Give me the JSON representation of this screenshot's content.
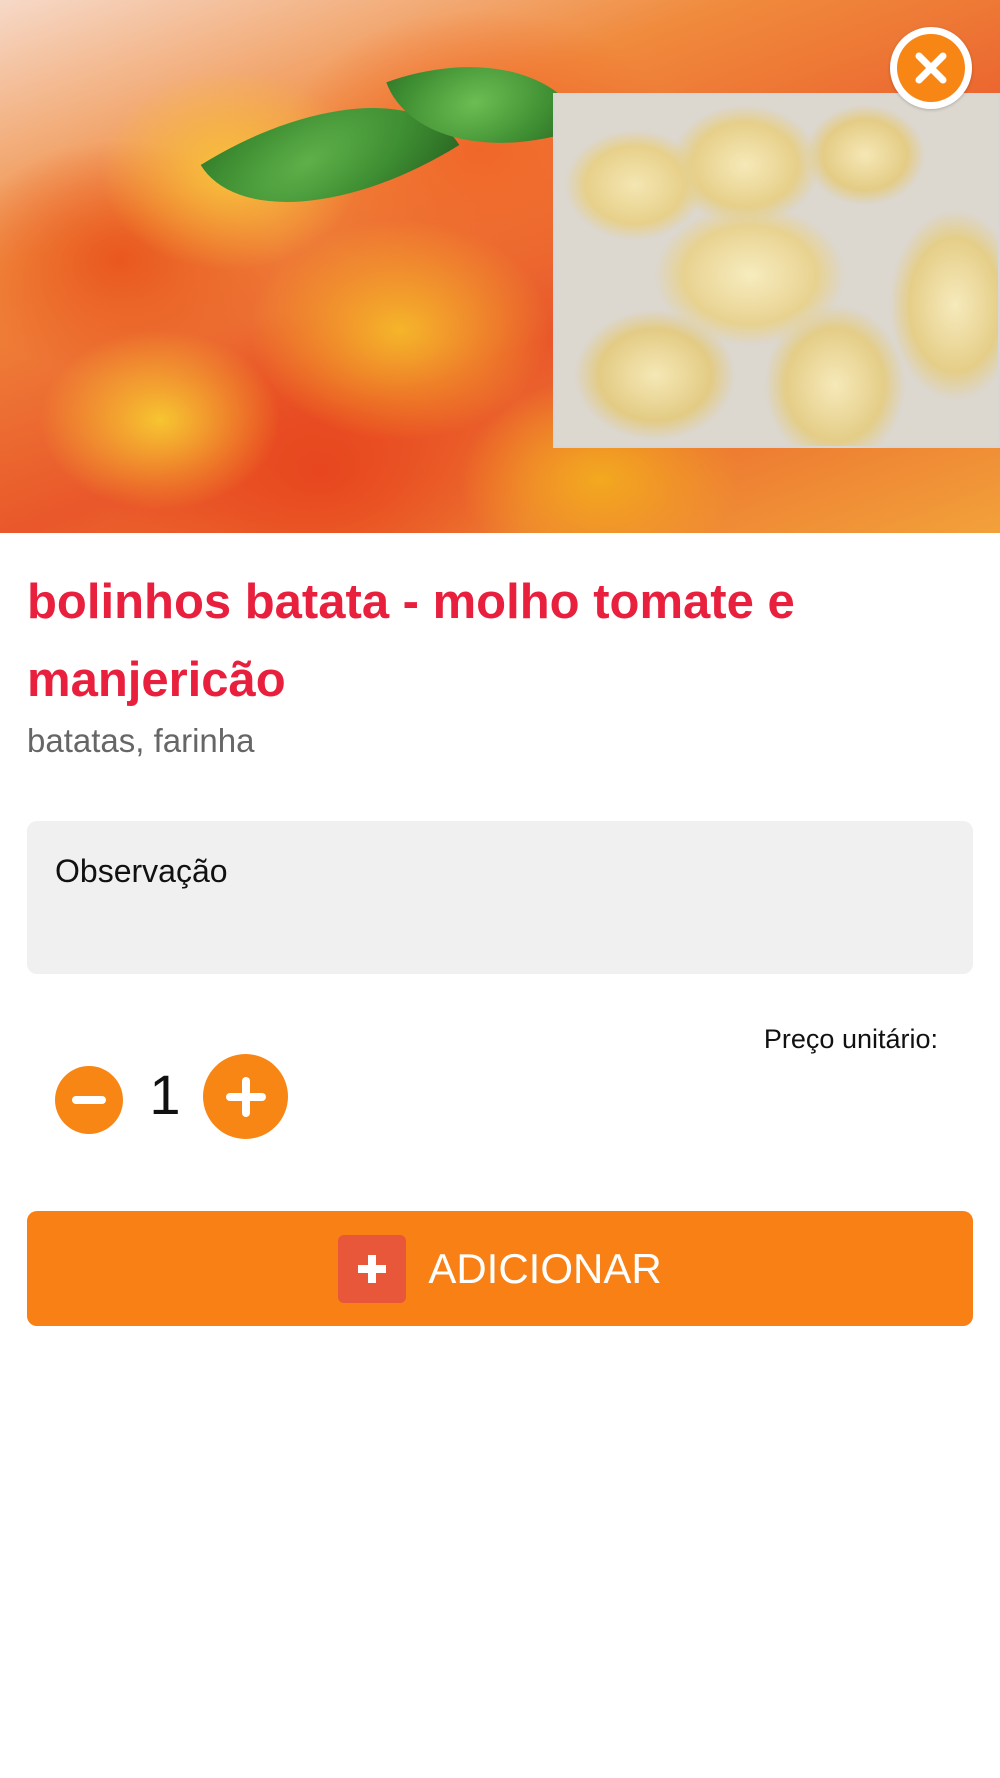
{
  "product": {
    "title": "bolinhos batata - molho tomate e manjericão",
    "ingredients": "batatas, farinha"
  },
  "observation": {
    "placeholder": "Observação"
  },
  "pricing": {
    "unit_price_label": "Preço unitário:"
  },
  "quantity": {
    "value": "1"
  },
  "actions": {
    "add_label": "ADICIONAR"
  },
  "colors": {
    "accent": "#f88615",
    "title": "#e8203e",
    "add_icon_bg": "#e8573a",
    "field_bg": "#f0f0f0"
  },
  "icons": {
    "close": "close-icon",
    "minus": "minus-icon",
    "plus": "plus-icon",
    "add": "plus-square-icon"
  }
}
